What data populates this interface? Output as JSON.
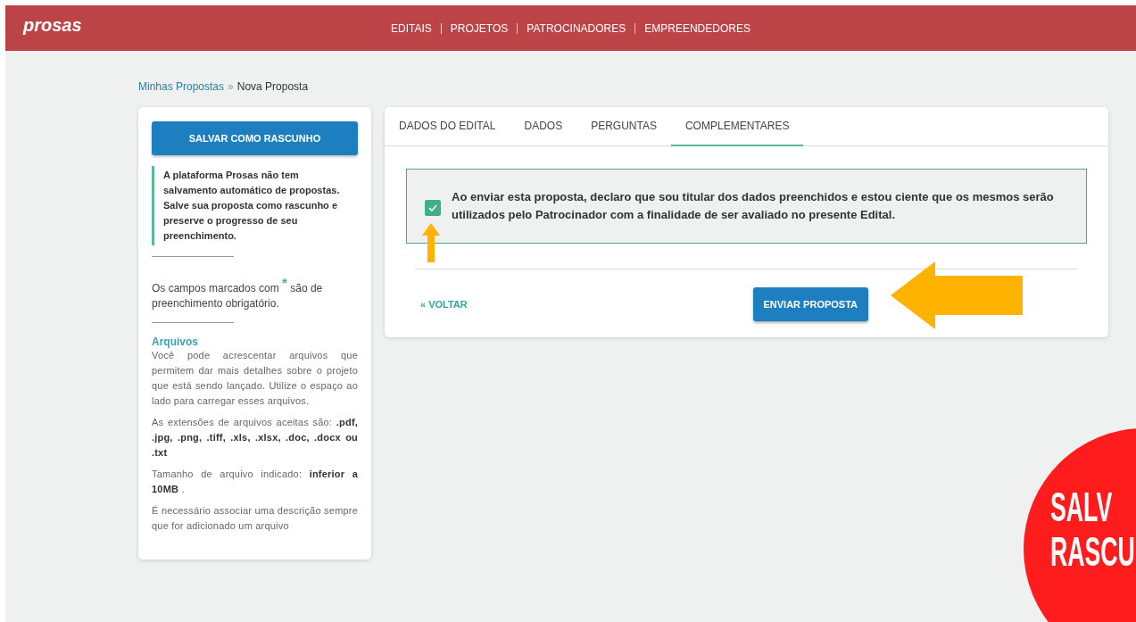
{
  "header": {
    "logo": "prosas",
    "nav": [
      "EDITAIS",
      "PROJETOS",
      "PATROCINADORES",
      "EMPREENDEDORES"
    ]
  },
  "breadcrumb": {
    "items": [
      "Minhas Propostas",
      "Nova Proposta"
    ],
    "separator": "»"
  },
  "sidebar": {
    "save_button": "SALVAR COMO RASCUNHO",
    "notice": "A plataforma Prosas não tem salvamento automático de propostas. Salve sua proposta como rascunho e preserve o progresso de seu preenchimento.",
    "required_note": "Os campos marcados com $^{*}$ são de preenchimento obrigatório.",
    "files_title": "Arquivos",
    "files_paragraphs": [
      "Você pode acrescentar arquivos que permitem dar mais detalhes sobre o projeto que está sendo lançado. Utilize o espaço ao lado para carregar esses arquivos.",
      "As extensões de arquivos aceitas são: **.pdf, .jpg, .png, .tiff, .xls, .xlsx, .doc, .docx ou .txt**",
      "Tamanho de arquivo indicado: **inferior a 10MB** .",
      "É necessário associar uma descrição sempre que for adicionado um arquivo"
    ]
  },
  "tabs": [
    {
      "label": "DADOS DO EDITAL",
      "selected": false
    },
    {
      "label": "DADOS",
      "selected": false
    },
    {
      "label": "PERGUNTAS",
      "selected": false
    },
    {
      "label": "COMPLEMENTARES",
      "selected": true
    }
  ],
  "consent": {
    "checked": true,
    "text": "Ao enviar esta proposta, declaro que sou titular dos dados preenchidos e estou ciente que os mesmos serão utilizados pelo Patrocinador com a finalidade de ser avaliado no presente Edital."
  },
  "back_link": "« VOLTAR",
  "submit_button": "ENVIAR PROPOSTA",
  "overlay_badge": {
    "lines": [
      "SALV",
      "RASCU"
    ]
  }
}
